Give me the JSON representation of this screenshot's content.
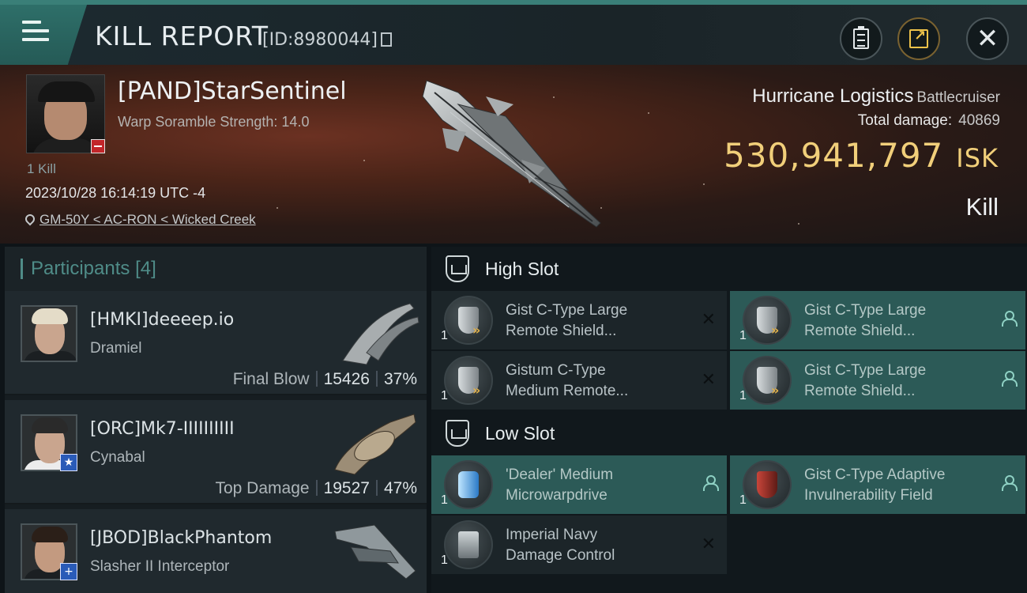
{
  "header": {
    "title": "KILL REPORT",
    "report_id": "[ID:8980044]"
  },
  "victim": {
    "name": "[PAND]StarSentinel",
    "warp_scramble": "Warp Soramble Strength: 14.0",
    "kills": "1 Kill",
    "datetime": "2023/10/28 16:14:19 UTC -4",
    "location": "GM-50Y < AC-RON < Wicked Creek",
    "ship_name": "Hurricane Logistics",
    "ship_class": "Battlecruiser",
    "total_damage_label": "Total damage:",
    "total_damage": "40869",
    "isk_value": "530,941,797",
    "isk_unit": "ISK",
    "result": "Kill"
  },
  "participants": {
    "label": "Participants",
    "count": "[4]",
    "items": [
      {
        "name": "[HMKI]deeeep.io",
        "ship": "Dramiel",
        "role": "Final Blow",
        "damage": "15426",
        "percent": "37%"
      },
      {
        "name": "[ORC]Mk7-IIIIIIIIII",
        "ship": "Cynabal",
        "role": "Top Damage",
        "damage": "19527",
        "percent": "47%"
      },
      {
        "name": "[JBOD]BlackPhantom",
        "ship": "Slasher II Interceptor"
      }
    ]
  },
  "fitting": {
    "high_slot_label": "High Slot",
    "low_slot_label": "Low Slot",
    "high": [
      {
        "qty": "1",
        "name_line1": "Gist C-Type Large",
        "name_line2": "Remote Shield...",
        "status": "destroyed"
      },
      {
        "qty": "1",
        "name_line1": "Gist C-Type Large",
        "name_line2": "Remote Shield...",
        "status": "dropped"
      },
      {
        "qty": "1",
        "name_line1": "Gistum C-Type",
        "name_line2": "Medium Remote...",
        "status": "destroyed"
      },
      {
        "qty": "1",
        "name_line1": "Gist C-Type Large",
        "name_line2": "Remote Shield...",
        "status": "dropped"
      }
    ],
    "low": [
      {
        "qty": "1",
        "name_line1": "'Dealer' Medium",
        "name_line2": "Microwarpdrive",
        "status": "dropped"
      },
      {
        "qty": "1",
        "name_line1": "Gist C-Type Adaptive",
        "name_line2": "Invulnerability Field",
        "status": "dropped"
      },
      {
        "qty": "1",
        "name_line1": "Imperial Navy",
        "name_line2": "Damage Control",
        "status": "destroyed"
      }
    ]
  },
  "icons": {
    "menu": "menu-icon",
    "copy": "copy-icon",
    "clipboard": "clipboard-icon",
    "share": "share-icon",
    "close": "close-icon",
    "location": "location-pin-icon",
    "destroyed": "x-icon",
    "dropped": "person-icon"
  },
  "colors": {
    "accent": "#3a7f78",
    "isk": "#f1cf7a",
    "owned_module": "#2c5a57"
  }
}
